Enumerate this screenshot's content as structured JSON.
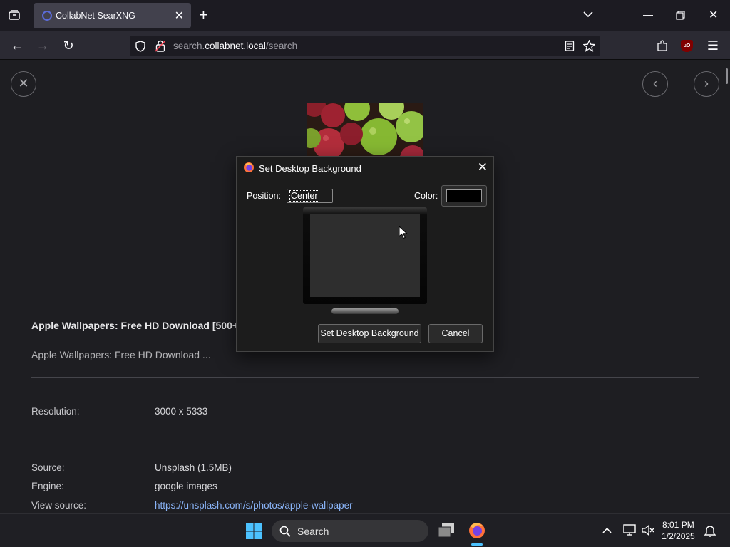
{
  "browser": {
    "tab_title": "CollabNet SearXNG",
    "url_prefix": "search.",
    "url_host": "collabnet.local",
    "url_path": "/search"
  },
  "result": {
    "title": "Apple Wallpapers: Free HD Download [500+ H",
    "description": "Apple Wallpapers: Free HD Download ...",
    "details": [
      {
        "label": "Resolution:",
        "value": "3000 x 5333"
      },
      {
        "label": "Source:",
        "value": "Unsplash (1.5MB)"
      },
      {
        "label": "Engine:",
        "value": "google images"
      },
      {
        "label": "View source:",
        "value": "https://unsplash.com/s/photos/apple-wallpaper"
      }
    ]
  },
  "dialog": {
    "title": "Set Desktop Background",
    "position_label": "Position:",
    "position_value": "Center",
    "color_label": "Color:",
    "color_value": "#000000",
    "ok_label": "Set Desktop Background",
    "cancel_label": "Cancel"
  },
  "taskbar": {
    "search_label": "Search",
    "time": "8:01 PM",
    "date": "1/2/2025"
  },
  "colors": {
    "accent_link": "#8ab4f8",
    "content_bg": "#1e1e22",
    "dialog_bg": "#1c1c1c"
  }
}
